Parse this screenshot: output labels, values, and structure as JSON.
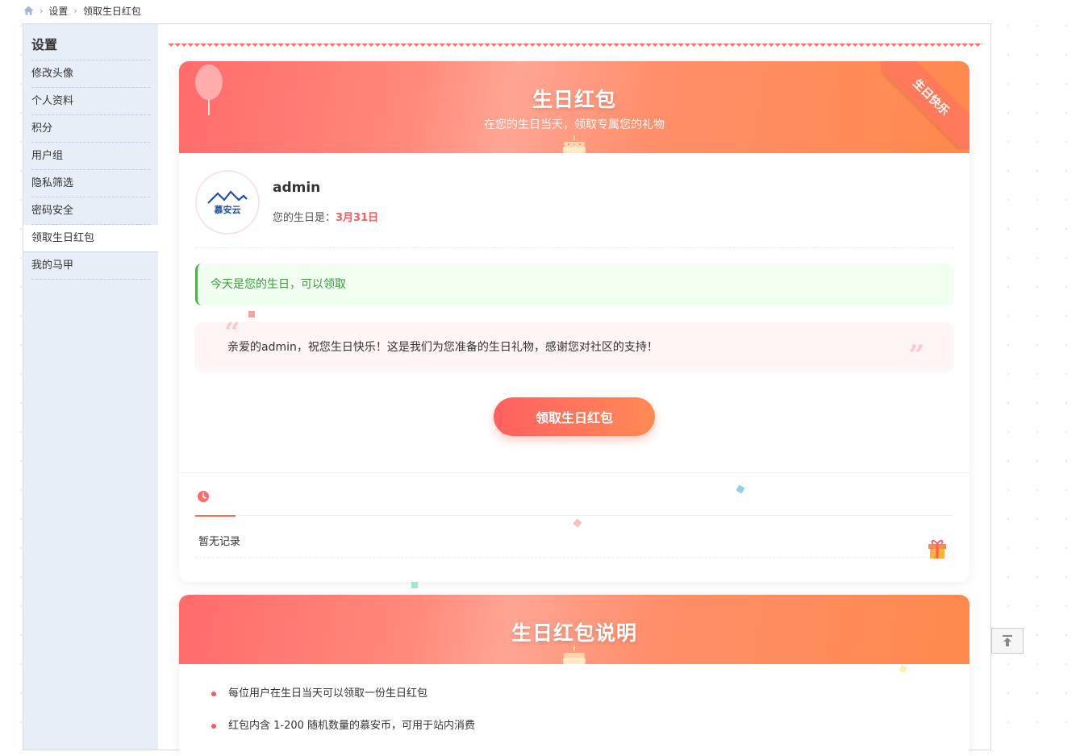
{
  "breadcrumb": {
    "home_icon": "home-icon",
    "items": [
      "设置",
      "领取生日红包"
    ]
  },
  "sidebar": {
    "title": "设置",
    "items": [
      "修改头像",
      "个人资料",
      "积分",
      "用户组",
      "隐私筛选",
      "密码安全",
      "领取生日红包",
      "我的马甲"
    ],
    "active_index": 6
  },
  "hero": {
    "title": "生日红包",
    "subtitle": "在您的生日当天，领取专属您的礼物",
    "ribbon": "生日快乐"
  },
  "user": {
    "name": "admin",
    "birthday_label": "您的生日是：",
    "birthday": "3月31日",
    "avatar_text": "慕安云"
  },
  "alert": {
    "text": "今天是您的生日，可以领取"
  },
  "greeting": {
    "open_quote": "“",
    "close_quote": "”",
    "text": "亲爱的admin，祝您生日快乐！这是我们为您准备的生日礼物，感谢您对社区的支持！"
  },
  "claim_button": "领取生日红包",
  "records": {
    "tab_icon": "clock-icon",
    "empty_text": "暂无记录"
  },
  "info": {
    "title": "生日红包说明",
    "items": [
      "每位用户在生日当天可以领取一份生日红包",
      "红包内含 1-200 随机数量的慕安币，可用于站内消费"
    ]
  },
  "colors": {
    "accent": "#ff6b6b",
    "accent2": "#ff8a4d",
    "success": "#3a9a3a",
    "sidebar_bg": "#e8eef7"
  }
}
